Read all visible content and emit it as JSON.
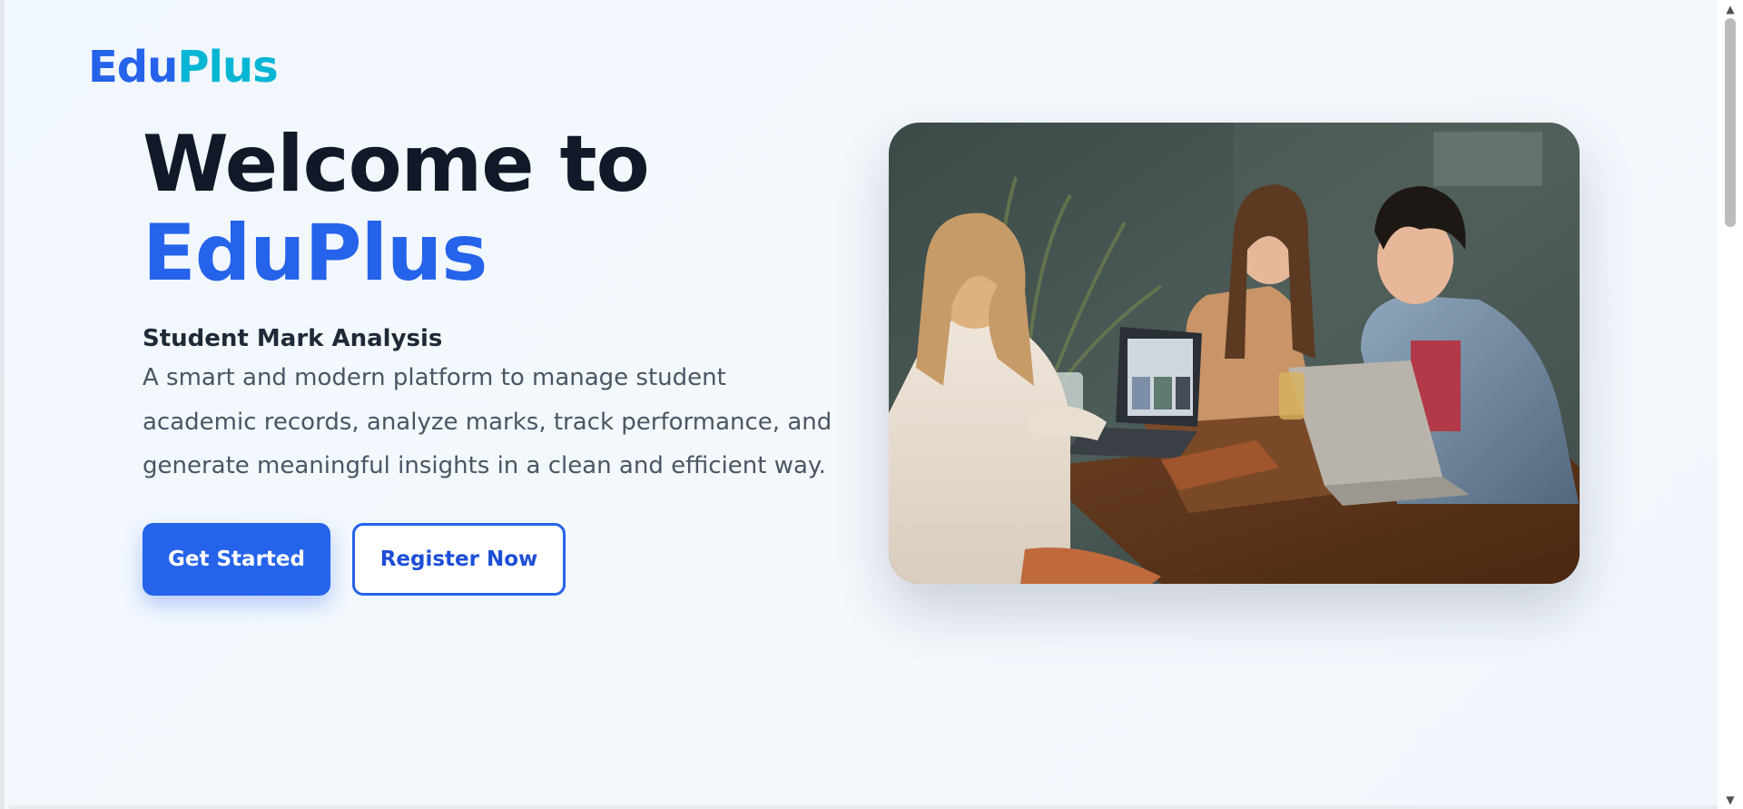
{
  "brand": {
    "logo_part1": "Edu",
    "logo_part2": "Plus",
    "colors": {
      "primary": "#2563eb",
      "secondary": "#06b6d4"
    }
  },
  "hero": {
    "headline_line1": "Welcome to",
    "headline_line2": "EduPlus",
    "subtitle": "Student Mark Analysis",
    "description": "A smart and modern platform to manage student academic records, analyze marks, track performance, and generate meaningful insights in a clean and efficient way.",
    "primary_button": "Get Started",
    "secondary_button": "Register Now",
    "image_icon": "students-collaborating-photo"
  },
  "scrollbar": {
    "up_icon": "▲",
    "down_icon": "▼"
  }
}
